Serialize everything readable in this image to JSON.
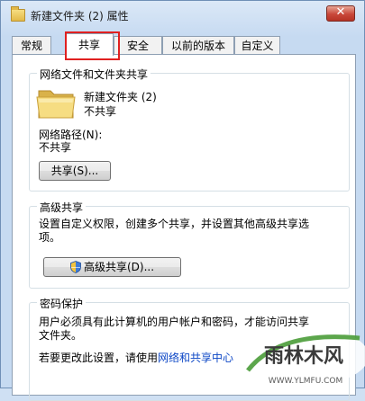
{
  "window": {
    "title": "新建文件夹 (2) 属性",
    "close_glyph": "✕"
  },
  "tabs": [
    "常规",
    "共享",
    "安全",
    "以前的版本",
    "自定义"
  ],
  "active_tab": 1,
  "network_sharing": {
    "heading": "网络文件和文件夹共享",
    "folder_name": "新建文件夹 (2)",
    "folder_status": "不共享",
    "path_label": "网络路径(N):",
    "path_value": "不共享",
    "share_button": "共享(S)..."
  },
  "advanced_sharing": {
    "heading": "高级共享",
    "description_line1": "设置自定义权限，创建多个共享，并设置其他高级共享选",
    "description_line2": "项。",
    "button": "高级共享(D)..."
  },
  "password_protection": {
    "heading": "密码保护",
    "description_line1": "用户必须具有此计算机的用户帐户和密码，才能访问共享",
    "description_line2": "文件夹。",
    "change_prefix": "若要更改此设置，请使用",
    "change_link": "网络和共享中心"
  },
  "watermark": {
    "brand": "雨林木风",
    "url": "WWW.YLMFU.COM"
  },
  "icons": {
    "title": "folder-icon",
    "folder": "folder-icon",
    "advanced": "uac-shield-icon",
    "close": "close-icon"
  },
  "colors": {
    "close_button": "#c9483a",
    "link": "#0d47c6",
    "highlight_box": "#e02020"
  }
}
